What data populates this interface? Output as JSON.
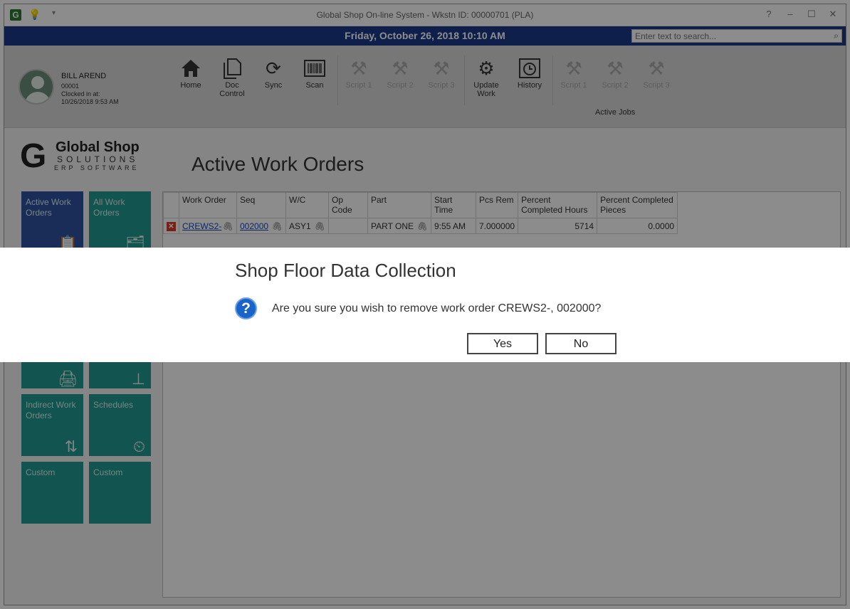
{
  "window": {
    "title": "Global Shop On-line System - Wkstn ID: 00000701 (PLA)",
    "app_icon": "G",
    "controls": [
      "?",
      "–",
      "☐",
      "✕"
    ]
  },
  "datebar": {
    "date": "Friday, October 26, 2018 10:10 AM",
    "search_placeholder": "Enter text to search..."
  },
  "user": {
    "name": "BILL AREND",
    "id": "00001",
    "clocked_label": "Clocked in at:",
    "clocked_time": "10/26/2018 9:53 AM"
  },
  "ribbon": {
    "buttons": [
      {
        "label": "Home",
        "icon": "home-icon"
      },
      {
        "label": "Doc Control",
        "icon": "document-icon"
      },
      {
        "label": "Sync",
        "icon": "sync-icon"
      },
      {
        "label": "Scan",
        "icon": "barcode-icon"
      },
      {
        "label": "Script 1",
        "icon": "tools-icon"
      },
      {
        "label": "Script 2",
        "icon": "tools-icon"
      },
      {
        "label": "Script 3",
        "icon": "tools-icon"
      },
      {
        "label": "Update Work",
        "icon": "gears-icon"
      },
      {
        "label": "History",
        "icon": "history-icon"
      },
      {
        "label": "Script 1",
        "icon": "tools-icon"
      },
      {
        "label": "Script 2",
        "icon": "tools-icon"
      },
      {
        "label": "Script 3",
        "icon": "tools-icon"
      }
    ],
    "group_label": "Active Jobs"
  },
  "logo": {
    "line1": "Global Shop",
    "line2": "SOLUTIONS",
    "line3": "ERP SOFTWARE"
  },
  "page_title": "Active Work Orders",
  "tiles": [
    {
      "label": "Active Work Orders"
    },
    {
      "label": "All Work Orders"
    },
    {
      "label": "Indirect Work Orders"
    },
    {
      "label": "Schedules"
    },
    {
      "label": "Custom"
    },
    {
      "label": "Custom"
    }
  ],
  "table": {
    "columns": [
      "Work Order",
      "Seq",
      "W/C",
      "Op Code",
      "Part",
      "Start Time",
      "Pcs Rem",
      "Percent Completed Hours",
      "Percent Completed Pieces"
    ],
    "rows": [
      {
        "work_order": "CREWS2-",
        "seq": "002000",
        "wc": "ASY1",
        "op_code": "",
        "part": "PART ONE",
        "start_time": "9:55 AM",
        "pcs_rem": "7.000000",
        "pct_hours": "5714",
        "pct_pieces": "0.0000"
      }
    ]
  },
  "dialog": {
    "title": "Shop Floor Data Collection",
    "message": "Are you sure you wish to remove work order CREWS2-, 002000?",
    "yes_label": "Yes",
    "no_label": "No"
  },
  "colors": {
    "datebar": "#1a3a8a",
    "tile": "#1f9a93",
    "tile_active": "#3050a0",
    "link": "#1b48b8"
  }
}
